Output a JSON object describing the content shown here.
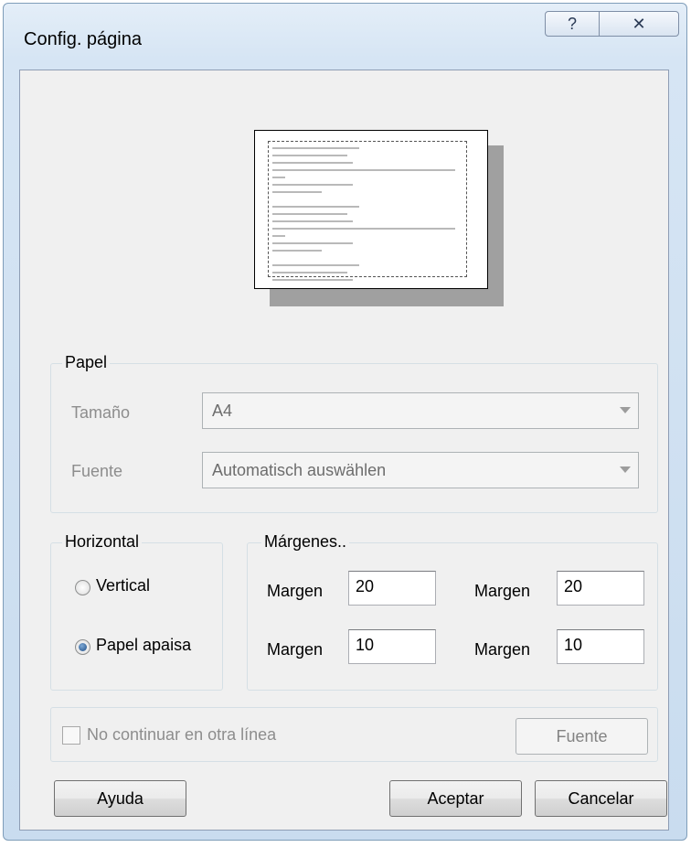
{
  "window": {
    "title": "Config. página",
    "help_glyph": "?",
    "close_glyph": "✕"
  },
  "paper": {
    "legend": "Papel",
    "size_label": "Tamaño",
    "size_value": "A4",
    "source_label": "Fuente",
    "source_value": "Automatisch auswählen"
  },
  "orientation": {
    "legend": "Horizontal",
    "vertical_label": "Vertical",
    "landscape_label": "Papel apaisa",
    "selected": "landscape"
  },
  "margins": {
    "legend": "Márgenes..",
    "items": [
      {
        "label": "Margen",
        "value": "20"
      },
      {
        "label": "Margen",
        "value": "20"
      },
      {
        "label": "Margen",
        "value": "10"
      },
      {
        "label": "Margen",
        "value": "10"
      }
    ]
  },
  "options": {
    "no_wrap_label": "No continuar en otra línea",
    "no_wrap_checked": false,
    "font_button": "Fuente"
  },
  "buttons": {
    "help": "Ayuda",
    "ok": "Aceptar",
    "cancel": "Cancelar"
  }
}
